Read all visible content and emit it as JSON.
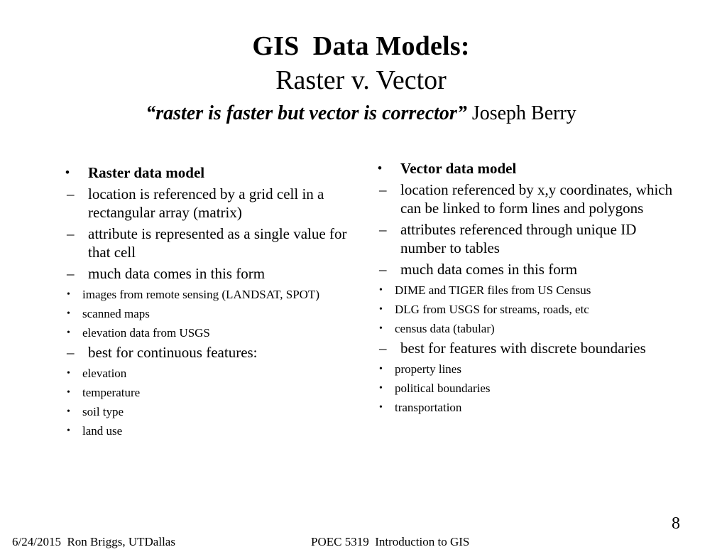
{
  "slide": {
    "title_line_1": "GIS  Data Models:",
    "title_line_2": "Raster v. Vector",
    "subtitle_quote": "“raster is faster but vector is corrector”",
    "subtitle_attribution": " Joseph Berry",
    "background_color": "#ffffff",
    "text_color": "#000000"
  },
  "bullets": {
    "round": "•",
    "dash": "–"
  },
  "left_column": {
    "heading": "Raster data model",
    "points": [
      {
        "text": "location is referenced by a grid cell in a rectangular array (matrix)",
        "sub": []
      },
      {
        "text": "attribute is represented as a single value for that cell",
        "sub": []
      },
      {
        "text": "much data comes in  this form",
        "sub": [
          "images from remote sensing (LANDSAT,  SPOT)",
          "scanned maps",
          "elevation data from USGS"
        ]
      },
      {
        "text": "best for continuous features:",
        "sub": [
          "elevation",
          "temperature",
          "soil type",
          "land use"
        ]
      }
    ]
  },
  "right_column": {
    "heading": "Vector data model",
    "points": [
      {
        "text": "location referenced by x,y coordinates, which can be linked to form lines and polygons",
        "sub": []
      },
      {
        "text": "attributes referenced through unique ID number to tables",
        "sub": []
      },
      {
        "text": "much data comes in this form",
        "sub": [
          "DIME and TIGER files from US Census",
          "DLG from USGS for streams, roads, etc",
          "census data (tabular)"
        ]
      },
      {
        "text": "best for features with discrete boundaries",
        "sub": [
          "property lines",
          "political boundaries",
          "transportation"
        ]
      }
    ]
  },
  "footer": {
    "date_author": "6/24/2015  Ron Briggs, UTDallas",
    "course": "POEC 5319  Introduction to GIS",
    "page_number": "8"
  }
}
